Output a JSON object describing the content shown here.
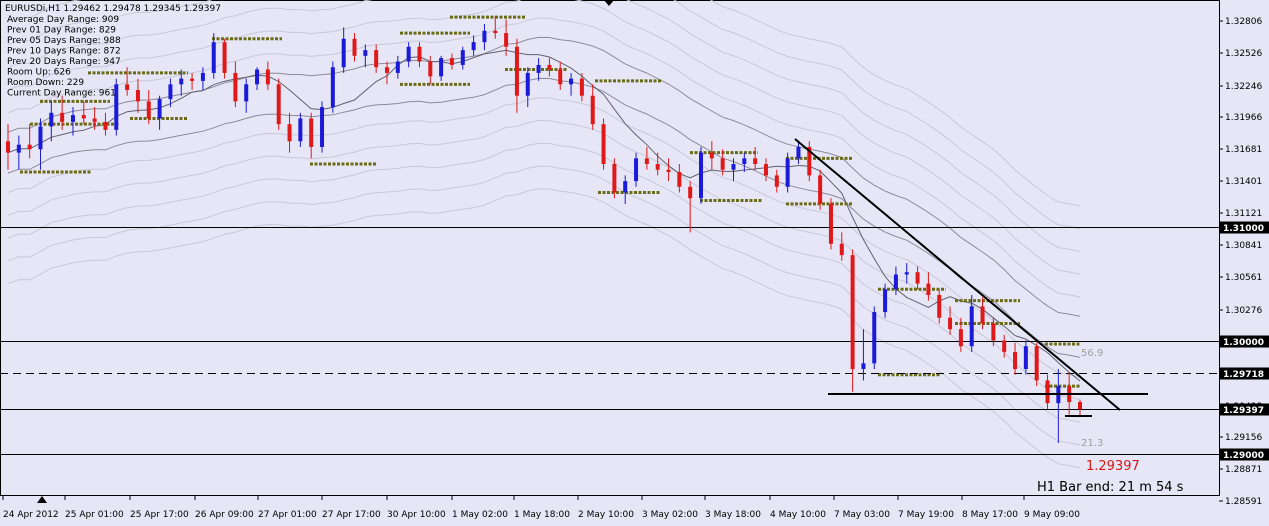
{
  "chart_data": {
    "type": "candlestick",
    "symbol_header": "EURUSDi,H1  1.29462 1.29478 1.29345 1.29397",
    "info_lines": [
      "Average Day  Range: 909",
      "Prev 01  Day  Range: 829",
      "Prev 05  Days Range: 988",
      "Prev 10  Days Range: 872",
      "Prev 20  Days Range: 947",
      "Room Up:       626",
      "Room Down: 229",
      "Current  Day Range: 961"
    ],
    "y_range": [
      1.2845,
      1.3297
    ],
    "y_ticks": [
      "1.32806",
      "1.32526",
      "1.32246",
      "1.31966",
      "1.31681",
      "1.31401",
      "1.31121",
      "1.30841",
      "1.30561",
      "1.30276",
      "1.29997",
      "1.29718",
      "1.29438",
      "1.29156",
      "1.28871",
      "1.28591"
    ],
    "x_ticks": [
      "24 Apr 2012",
      "25 Apr 01:00",
      "25 Apr 17:00",
      "26 Apr 09:00",
      "27 Apr 01:00",
      "27 Apr 17:00",
      "30 Apr 10:00",
      "1 May 02:00",
      "1 May 18:00",
      "2 May 10:00",
      "3 May 02:00",
      "3 May 18:00",
      "4 May 10:00",
      "7 May 03:00",
      "7 May 19:00",
      "8 May 17:00",
      "9 May 09:00"
    ],
    "horizontal_levels": [
      {
        "value": "1.31000",
        "price": 1.31,
        "style": "solid"
      },
      {
        "value": "1.30000",
        "price": 1.3,
        "style": "solid"
      },
      {
        "value": "1.29718",
        "price": 1.29718,
        "style": "dashed"
      },
      {
        "value": "1.29397",
        "price": 1.29397,
        "style": "solid",
        "current": true
      },
      {
        "value": "1.29000",
        "price": 1.29,
        "style": "solid"
      }
    ],
    "annotations": {
      "upper_pct": "56.9",
      "lower_pct": "21.3",
      "current_price": "1.29397",
      "bar_end": "H1 Bar end: 21 m 54 s"
    },
    "candles": [
      [
        1.3175,
        1.319,
        1.315,
        1.3165
      ],
      [
        1.3165,
        1.318,
        1.315,
        1.3172
      ],
      [
        1.3172,
        1.319,
        1.316,
        1.3168
      ],
      [
        1.3168,
        1.3195,
        1.315,
        1.3188
      ],
      [
        1.3188,
        1.321,
        1.3175,
        1.32
      ],
      [
        1.32,
        1.3215,
        1.3185,
        1.3192
      ],
      [
        1.3192,
        1.3205,
        1.318,
        1.3198
      ],
      [
        1.3198,
        1.321,
        1.319,
        1.3195
      ],
      [
        1.3195,
        1.3205,
        1.3185,
        1.3192
      ],
      [
        1.3192,
        1.32,
        1.318,
        1.3185
      ],
      [
        1.3185,
        1.323,
        1.318,
        1.3225
      ],
      [
        1.3225,
        1.324,
        1.3215,
        1.322
      ],
      [
        1.322,
        1.323,
        1.32,
        1.321
      ],
      [
        1.321,
        1.322,
        1.319,
        1.3195
      ],
      [
        1.3195,
        1.3215,
        1.3185,
        1.3212
      ],
      [
        1.3212,
        1.323,
        1.3205,
        1.3225
      ],
      [
        1.3225,
        1.3238,
        1.3215,
        1.323
      ],
      [
        1.323,
        1.3235,
        1.322,
        1.3228
      ],
      [
        1.3228,
        1.324,
        1.322,
        1.3235
      ],
      [
        1.3235,
        1.327,
        1.323,
        1.3262
      ],
      [
        1.3262,
        1.3265,
        1.323,
        1.3235
      ],
      [
        1.3235,
        1.3245,
        1.3205,
        1.321
      ],
      [
        1.321,
        1.323,
        1.32,
        1.3225
      ],
      [
        1.3225,
        1.324,
        1.322,
        1.3238
      ],
      [
        1.3238,
        1.3245,
        1.322,
        1.3225
      ],
      [
        1.3225,
        1.323,
        1.3185,
        1.319
      ],
      [
        1.319,
        1.32,
        1.3165,
        1.3175
      ],
      [
        1.3175,
        1.32,
        1.317,
        1.3195
      ],
      [
        1.3195,
        1.32,
        1.316,
        1.317
      ],
      [
        1.317,
        1.321,
        1.3165,
        1.3205
      ],
      [
        1.3205,
        1.3245,
        1.32,
        1.324
      ],
      [
        1.324,
        1.3275,
        1.3235,
        1.3265
      ],
      [
        1.3265,
        1.327,
        1.3245,
        1.325
      ],
      [
        1.325,
        1.326,
        1.324,
        1.3255
      ],
      [
        1.3255,
        1.326,
        1.3235,
        1.324
      ],
      [
        1.324,
        1.3245,
        1.3225,
        1.3235
      ],
      [
        1.3235,
        1.325,
        1.323,
        1.3245
      ],
      [
        1.3245,
        1.3262,
        1.324,
        1.3258
      ],
      [
        1.3258,
        1.3262,
        1.324,
        1.3245
      ],
      [
        1.3245,
        1.325,
        1.3225,
        1.3232
      ],
      [
        1.3232,
        1.325,
        1.3228,
        1.3248
      ],
      [
        1.3248,
        1.3252,
        1.3238,
        1.3242
      ],
      [
        1.3242,
        1.3258,
        1.3238,
        1.3255
      ],
      [
        1.3255,
        1.3268,
        1.325,
        1.3262
      ],
      [
        1.3262,
        1.3278,
        1.3255,
        1.3272
      ],
      [
        1.3272,
        1.3285,
        1.3265,
        1.327
      ],
      [
        1.327,
        1.3282,
        1.325,
        1.3258
      ],
      [
        1.3258,
        1.3265,
        1.32,
        1.3215
      ],
      [
        1.3215,
        1.324,
        1.3205,
        1.3235
      ],
      [
        1.3235,
        1.3248,
        1.3228,
        1.3242
      ],
      [
        1.3242,
        1.3248,
        1.3232,
        1.3238
      ],
      [
        1.3238,
        1.3245,
        1.322,
        1.3225
      ],
      [
        1.3225,
        1.3235,
        1.3215,
        1.323
      ],
      [
        1.323,
        1.3235,
        1.321,
        1.3215
      ],
      [
        1.3215,
        1.3225,
        1.3185,
        1.319
      ],
      [
        1.319,
        1.3195,
        1.315,
        1.3155
      ],
      [
        1.3155,
        1.316,
        1.3125,
        1.313
      ],
      [
        1.313,
        1.3145,
        1.312,
        1.314
      ],
      [
        1.314,
        1.3165,
        1.3135,
        1.316
      ],
      [
        1.316,
        1.317,
        1.315,
        1.3155
      ],
      [
        1.3155,
        1.3165,
        1.3145,
        1.315
      ],
      [
        1.315,
        1.316,
        1.314,
        1.3148
      ],
      [
        1.3148,
        1.3155,
        1.313,
        1.3135
      ],
      [
        1.3135,
        1.314,
        1.3095,
        1.3125
      ],
      [
        1.3125,
        1.317,
        1.312,
        1.3165
      ],
      [
        1.3165,
        1.3175,
        1.315,
        1.316
      ],
      [
        1.316,
        1.3168,
        1.3145,
        1.315
      ],
      [
        1.315,
        1.316,
        1.314,
        1.3155
      ],
      [
        1.3155,
        1.3165,
        1.3148,
        1.316
      ],
      [
        1.316,
        1.317,
        1.315,
        1.3155
      ],
      [
        1.3155,
        1.316,
        1.314,
        1.3145
      ],
      [
        1.3145,
        1.315,
        1.313,
        1.3135
      ],
      [
        1.3135,
        1.3165,
        1.313,
        1.316
      ],
      [
        1.316,
        1.3175,
        1.3155,
        1.317
      ],
      [
        1.317,
        1.3175,
        1.314,
        1.3145
      ],
      [
        1.3145,
        1.315,
        1.3115,
        1.312
      ],
      [
        1.312,
        1.3125,
        1.308,
        1.3085
      ],
      [
        1.3085,
        1.3095,
        1.307,
        1.3075
      ],
      [
        1.3075,
        1.308,
        1.2955,
        1.2975
      ],
      [
        1.2975,
        1.301,
        1.2965,
        1.298
      ],
      [
        1.298,
        1.303,
        1.2975,
        1.3025
      ],
      [
        1.3025,
        1.305,
        1.302,
        1.3045
      ],
      [
        1.3045,
        1.3065,
        1.304,
        1.3058
      ],
      [
        1.3058,
        1.3068,
        1.305,
        1.306
      ],
      [
        1.306,
        1.3065,
        1.3045,
        1.305
      ],
      [
        1.305,
        1.306,
        1.3035,
        1.304
      ],
      [
        1.304,
        1.3045,
        1.3015,
        1.302
      ],
      [
        1.302,
        1.303,
        1.3005,
        1.301
      ],
      [
        1.301,
        1.302,
        1.299,
        1.2995
      ],
      [
        1.2995,
        1.304,
        1.299,
        1.303
      ],
      [
        1.303,
        1.3038,
        1.301,
        1.3015
      ],
      [
        1.3015,
        1.302,
        1.2995,
        1.3
      ],
      [
        1.3,
        1.3005,
        1.2985,
        1.299
      ],
      [
        1.299,
        1.2998,
        1.297,
        1.2975
      ],
      [
        1.2975,
        1.3,
        1.297,
        1.2995
      ],
      [
        1.2995,
        1.2998,
        1.296,
        1.2965
      ],
      [
        1.2965,
        1.297,
        1.294,
        1.2945
      ],
      [
        1.2945,
        1.2975,
        1.291,
        1.296
      ],
      [
        1.296,
        1.2972,
        1.2935,
        1.2946
      ],
      [
        1.2946,
        1.2948,
        1.2934,
        1.29397
      ]
    ]
  }
}
